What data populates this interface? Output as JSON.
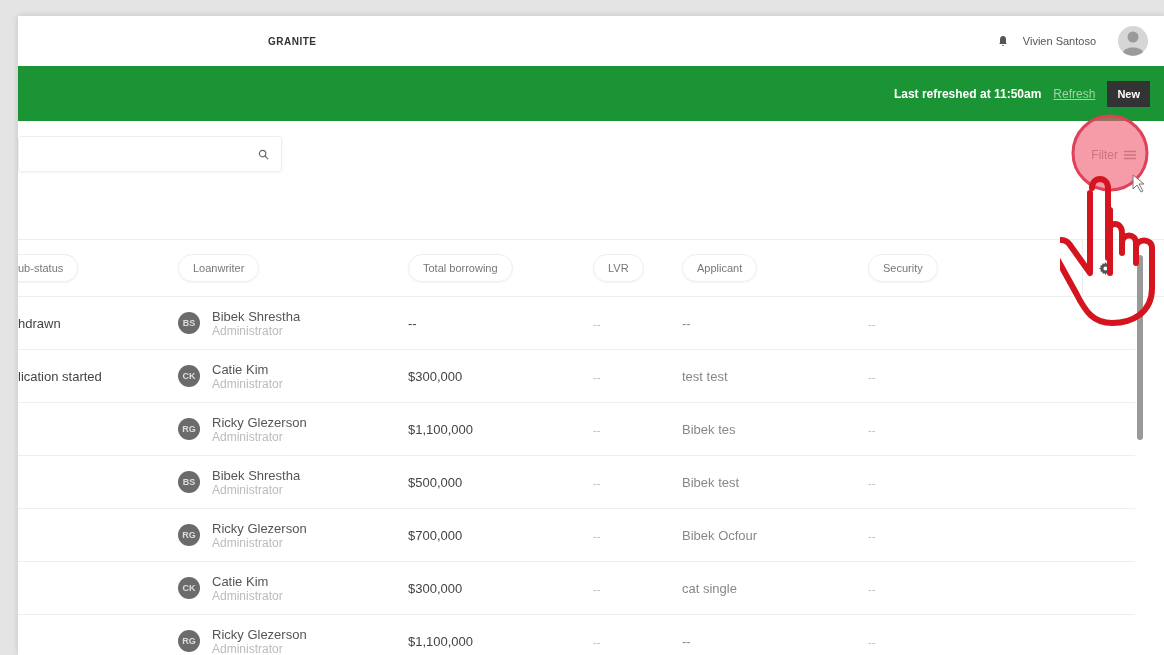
{
  "header": {
    "logo": "GRANITE",
    "user_name": "Vivien Santoso"
  },
  "banner": {
    "refreshed": "Last refreshed at 11:50am",
    "refresh_link": "Refresh",
    "new_button": "New"
  },
  "filter": {
    "label": "Filter"
  },
  "table": {
    "columns": [
      "ub-status",
      "Loanwriter",
      "Total borrowing",
      "LVR",
      "Applicant",
      "Security"
    ],
    "rows": [
      {
        "sub_status": "hdrawn",
        "initials": "BS",
        "loanwriter": "Bibek Shrestha",
        "role": "Administrator",
        "total_borrowing": "--",
        "lvr": "--",
        "applicant": "--",
        "security": "--"
      },
      {
        "sub_status": "lication started",
        "initials": "CK",
        "loanwriter": "Catie Kim",
        "role": "Administrator",
        "total_borrowing": "$300,000",
        "lvr": "--",
        "applicant": "test test",
        "security": "--"
      },
      {
        "initials": "RG",
        "loanwriter": "Ricky Glezerson",
        "role": "Administrator",
        "total_borrowing": "$1,100,000",
        "lvr": "--",
        "applicant": "Bibek tes",
        "security": "--"
      },
      {
        "initials": "BS",
        "loanwriter": "Bibek Shrestha",
        "role": "Administrator",
        "total_borrowing": "$500,000",
        "lvr": "--",
        "applicant": "Bibek test",
        "security": "--"
      },
      {
        "initials": "RG",
        "loanwriter": "Ricky Glezerson",
        "role": "Administrator",
        "total_borrowing": "$700,000",
        "lvr": "--",
        "applicant": "Bibek Ocfour",
        "security": "--"
      },
      {
        "initials": "CK",
        "loanwriter": "Catie Kim",
        "role": "Administrator",
        "total_borrowing": "$300,000",
        "lvr": "--",
        "applicant": "cat single",
        "security": "--"
      },
      {
        "initials": "RG",
        "loanwriter": "Ricky Glezerson",
        "role": "Administrator",
        "total_borrowing": "$1,100,000",
        "lvr": "--",
        "applicant": "--",
        "security": "--"
      }
    ]
  }
}
